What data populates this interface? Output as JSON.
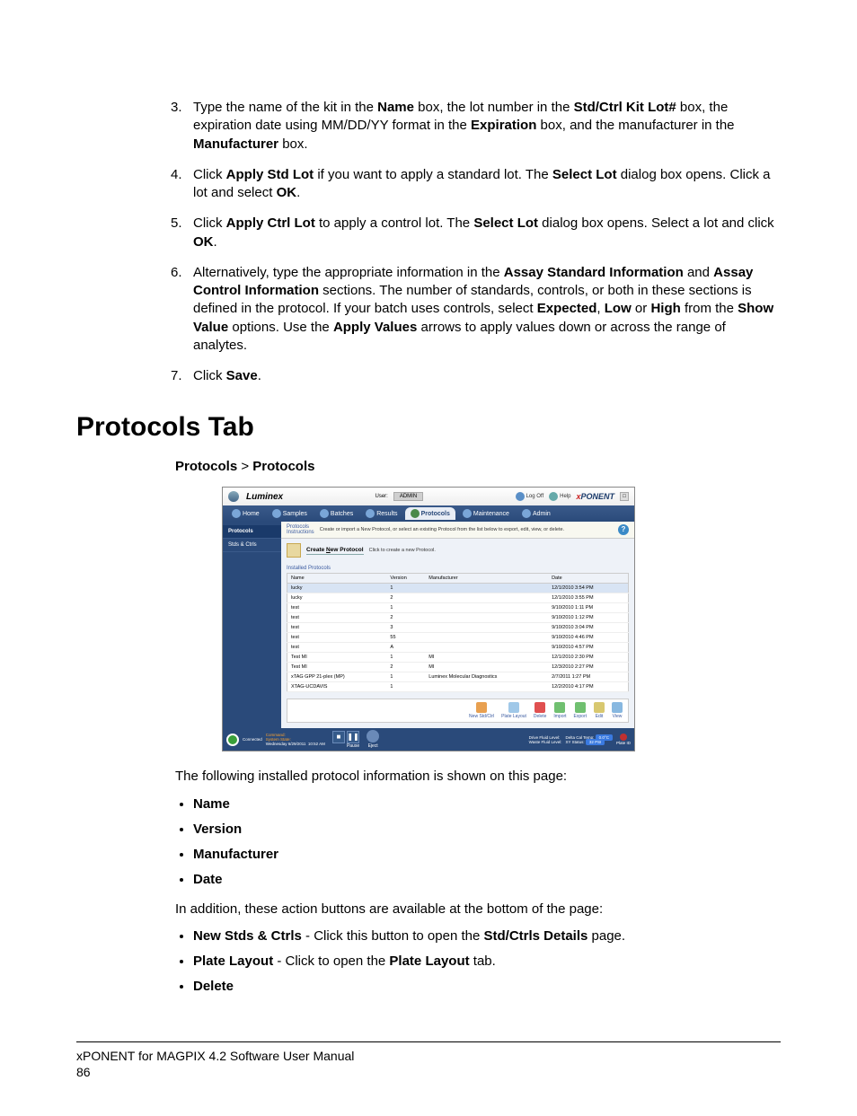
{
  "steps": {
    "s3": {
      "t1": "Type the name of the kit in the ",
      "b1": "Name",
      "t2": " box, the lot number in the ",
      "b2": "Std/Ctrl Kit Lot#",
      "t3": " box, the expiration date using MM/DD/YY format in the ",
      "b3": "Expiration",
      "t4": " box, and the manufacturer in the ",
      "b4": "Manufacturer",
      "t5": " box."
    },
    "s4": {
      "t1": "Click ",
      "b1": "Apply Std Lot",
      "t2": " if you want to apply a standard lot. The ",
      "b2": "Select Lot",
      "t3": " dialog box opens. Click a lot and select ",
      "b3": "OK",
      "t4": "."
    },
    "s5": {
      "t1": "Click ",
      "b1": "Apply Ctrl Lot",
      "t2": " to apply a control lot. The ",
      "b2": "Select Lot",
      "t3": " dialog box opens. Select a lot and click ",
      "b3": "OK",
      "t4": "."
    },
    "s6": {
      "t1": "Alternatively, type the appropriate information in the ",
      "b1": "Assay Standard Information",
      "t2": " and ",
      "b2": "Assay Control Information",
      "t3": " sections. The number of standards, controls, or both in these sections is defined in the protocol. If your batch uses controls, select ",
      "b3": "Expected",
      "t4": ", ",
      "b4": "Low",
      "t5": " or ",
      "b5": "High",
      "t6": " from the ",
      "b6": "Show Value",
      "t7": " options. Use the ",
      "b7": "Apply Values",
      "t8": " arrows to apply values down or across the range of analytes."
    },
    "s7": {
      "t1": "Click ",
      "b1": "Save",
      "t2": "."
    }
  },
  "section_title": "Protocols Tab",
  "breadcrumb": {
    "a": "Protocols",
    "sep": " > ",
    "b": "Protocols"
  },
  "screenshot": {
    "brand": "Luminex",
    "user_label": "User:",
    "user_value": "ADMIN",
    "logoff": "Log Off",
    "help": "Help",
    "product": "PONENT",
    "product_x": "x",
    "tabs": [
      "Home",
      "Samples",
      "Batches",
      "Results",
      "Protocols",
      "Maintenance",
      "Admin"
    ],
    "sidebar": [
      "Protocols",
      "Stds & Ctrls"
    ],
    "instr_head": "Protocols",
    "instr_label": "Instructions",
    "instr_text": "Create or import a New Protocol, or select an existing Protocol from the list below to export, edit, view, or delete.",
    "create_label_pre": "Create ",
    "create_label_u": "N",
    "create_label_post": "ew Protocol",
    "create_desc": "Click to create a new Protocol.",
    "fieldset_label": "Installed Protocols",
    "columns": [
      "Name",
      "Version",
      "Manufacturer",
      "Date"
    ],
    "rows": [
      {
        "name": "lucky",
        "version": "1",
        "mfr": "",
        "date": "12/1/2010 3:54 PM",
        "sel": true
      },
      {
        "name": "lucky",
        "version": "2",
        "mfr": "",
        "date": "12/1/2010 3:55 PM"
      },
      {
        "name": "test",
        "version": "1",
        "mfr": "",
        "date": "9/10/2010 1:11 PM"
      },
      {
        "name": "test",
        "version": "2",
        "mfr": "",
        "date": "9/10/2010 1:12 PM"
      },
      {
        "name": "test",
        "version": "3",
        "mfr": "",
        "date": "9/10/2010 3:04 PM"
      },
      {
        "name": "test",
        "version": "55",
        "mfr": "",
        "date": "9/10/2010 4:46 PM"
      },
      {
        "name": "test",
        "version": "A",
        "mfr": "",
        "date": "9/10/2010 4:57 PM"
      },
      {
        "name": "Test MI",
        "version": "1",
        "mfr": "MI",
        "date": "12/1/2010 2:30 PM"
      },
      {
        "name": "Test MI",
        "version": "2",
        "mfr": "MI",
        "date": "12/3/2010 2:27 PM"
      },
      {
        "name": "xTAG GPP 21-plex (MP)",
        "version": "1",
        "mfr": "Luminex Molecular Diagnostics",
        "date": "2/7/2011 1:27 PM"
      },
      {
        "name": "XTAG-UCDAVIS",
        "version": "1",
        "mfr": "",
        "date": "12/2/2010 4:17 PM"
      }
    ],
    "actions": [
      "New Std/Ctrl",
      "Plate Layout",
      "Delete",
      "Import",
      "Export",
      "Edit",
      "View"
    ],
    "status": {
      "connected": "Connected",
      "command_lbl": "Command:",
      "state_lbl": "System State:",
      "date": "Wednesday 6/29/2011",
      "time": "10:52 AM",
      "stop": "■",
      "pause": "❚❚",
      "pause_lbl": "Pause",
      "eject": "Eject",
      "drive_fluid": "Drive Fluid Level:",
      "waste_fluid": "Waste Fluid Level:",
      "delta_temp": "Delta Cal Temp:",
      "delta_temp_val": "0.0°C",
      "xy_status": "XY Status:",
      "xy_val": "32 PSI",
      "plate": "Plate ID"
    }
  },
  "after_text": "The following installed protocol information is shown on this page:",
  "info_bullets": [
    "Name",
    "Version",
    "Manufacturer",
    "Date"
  ],
  "action_text": "In addition, these action buttons are available at the bottom of the page:",
  "action_bullets": {
    "b1": {
      "name": "New Stds & Ctrls",
      "t1": " - Click this button to open the ",
      "b": "Std/Ctrls Details",
      "t2": " page."
    },
    "b2": {
      "name": "Plate Layout",
      "t1": " - Click to open the ",
      "b": "Plate Layout",
      "t2": " tab."
    },
    "b3": {
      "name": "Delete"
    }
  },
  "footer": {
    "line1": "xPONENT for MAGPIX 4.2 Software User Manual",
    "line2": "86"
  }
}
